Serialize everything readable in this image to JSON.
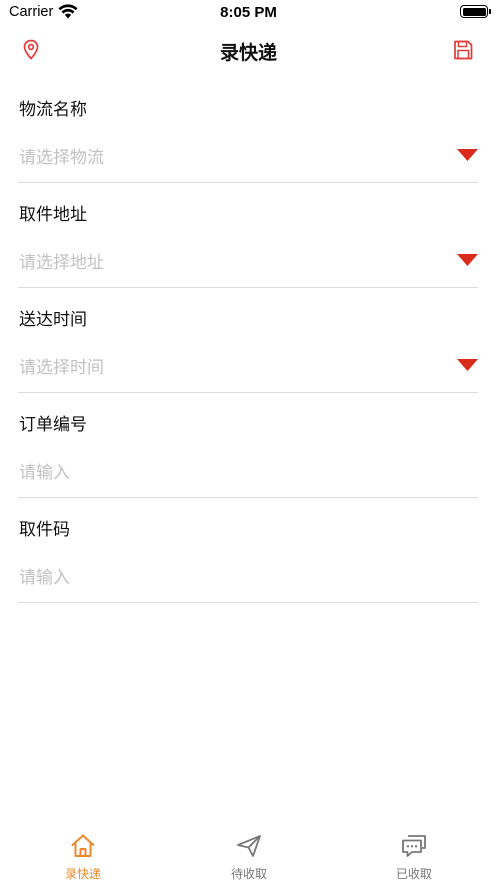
{
  "status_bar": {
    "carrier": "Carrier",
    "time": "8:05 PM"
  },
  "nav": {
    "title": "录快递",
    "left_icon": "location-pin-icon",
    "right_icon": "save-icon"
  },
  "form": {
    "fields": [
      {
        "label": "物流名称",
        "placeholder": "请选择物流",
        "type": "select"
      },
      {
        "label": "取件地址",
        "placeholder": "请选择地址",
        "type": "select"
      },
      {
        "label": "送达时间",
        "placeholder": "请选择时间",
        "type": "select"
      },
      {
        "label": "订单编号",
        "placeholder": "请输入",
        "type": "input"
      },
      {
        "label": "取件码",
        "placeholder": "请输入",
        "type": "input"
      }
    ]
  },
  "tabbar": {
    "tabs": [
      {
        "label": "录快递",
        "icon": "home-icon",
        "active": true
      },
      {
        "label": "待收取",
        "icon": "paper-plane-icon",
        "active": false
      },
      {
        "label": "已收取",
        "icon": "chat-bubbles-icon",
        "active": false
      }
    ]
  },
  "colors": {
    "accent": "#e33a3a",
    "dropdown": "#d92b1c",
    "tab_active": "#ea8a2d",
    "tab_inactive": "#777777",
    "placeholder": "#c2c2c2",
    "divider": "#dcdcdc"
  }
}
